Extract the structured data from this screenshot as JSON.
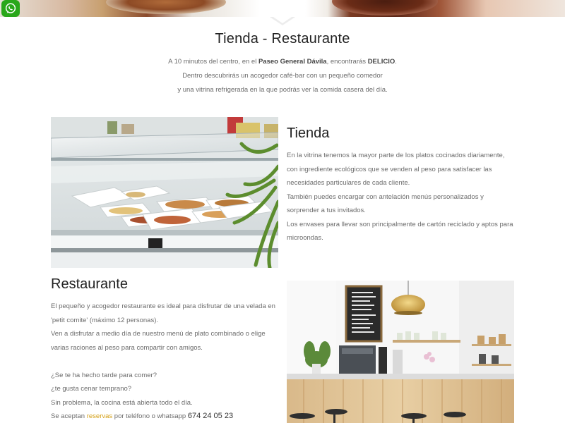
{
  "whatsapp": {
    "icon": "whatsapp-icon",
    "color": "#29a71a"
  },
  "header": {
    "title": "Tienda - Restaurante"
  },
  "intro": {
    "line1_pre": "A 10 minutos del centro, en el ",
    "line1_bold1": "Paseo General Dávila",
    "line1_mid": ", encontrarás ",
    "line1_bold2": "DELICIO",
    "line1_post": ".",
    "line2": "Dentro descubrirás un acogedor café-bar con un pequeño comedor",
    "line3": "y una vitrina refrigerada en la que podrás ver la comida casera del día."
  },
  "tienda": {
    "title": "Tienda",
    "paragraphs": [
      "En la vitrina tenemos la mayor parte de los platos cocinados diariamente, con ingrediente ecológicos que se venden al peso para satisfacer las necesidades particulares de cada cliente.",
      "También puedes encargar con antelación menús personalizados y sorprender a tus invitados.",
      "Los envases para llevar son principalmente de cartón reciclado y aptos para microondas."
    ]
  },
  "restaurante": {
    "title": "Restaurante",
    "p1": "El pequeño y acogedor restaurante es ideal para disfrutar de una velada en 'petit comite' (máximo 12 personas).",
    "p2": "Ven a disfrutar a medio día de nuestro menú de plato combinado o elige varias raciones al peso para compartir con amigos.",
    "q1": "¿Se te ha hecho tarde para comer?",
    "q2": "¿te gusta cenar temprano?",
    "q3": "Sin problema, la cocina está abierta todo el día.",
    "res_pre": "Se aceptan ",
    "res_link": "reservas",
    "res_mid": " por teléfono o whatsapp ",
    "phone": "674 24 05 23"
  },
  "colors": {
    "accent": "#d4a017",
    "text": "#6b6b6b",
    "heading": "#222222"
  }
}
